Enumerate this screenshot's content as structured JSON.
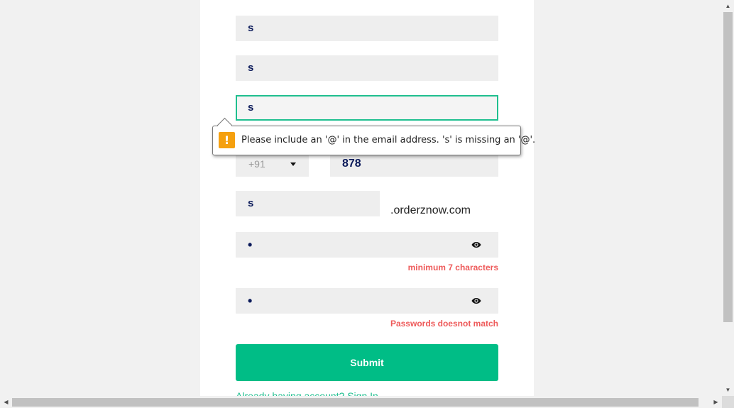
{
  "form": {
    "first_name_value": "s",
    "last_name_value": "s",
    "email_value": "s",
    "country_code": "+91",
    "phone_value": "878",
    "subdomain_value": "s",
    "domain_suffix": ".orderznow.com",
    "password_mask": "•",
    "password_error": "minimum 7 characters",
    "confirm_mask": "•",
    "confirm_error": "Passwords doesnot match",
    "submit_label": "Submit",
    "signin_text": "Already having account? Sign In"
  },
  "tooltip": {
    "icon": "warning-icon",
    "icon_glyph": "!",
    "message": "Please include an '@' in the email address. 's' is missing an '@'."
  },
  "icons": {
    "password_toggle": "eye-icon",
    "confirm_toggle": "eye-icon",
    "country_dropdown": "chevron-down-icon"
  },
  "colors": {
    "accent": "#00bd86",
    "error": "#ee5a5a",
    "warning": "#f5a00f",
    "input_text": "#0b1a5a"
  }
}
